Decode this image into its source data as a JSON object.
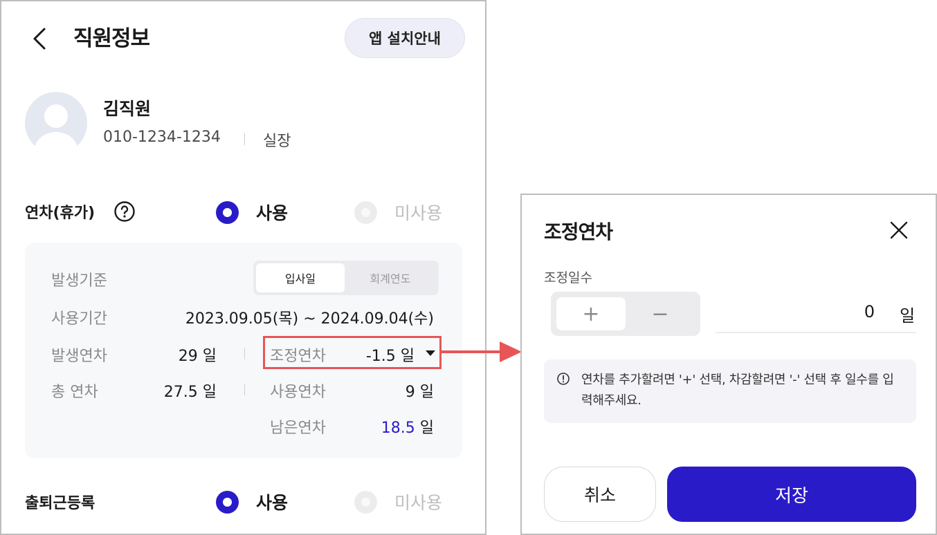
{
  "header": {
    "title": "직원정보",
    "install_label": "앱 설치안내"
  },
  "profile": {
    "name": "김직원",
    "phone": "010-1234-1234",
    "role": "실장"
  },
  "leave": {
    "label": "연차(휴가)",
    "radio_use": "사용",
    "radio_unuse": "미사용",
    "basis_label": "발생기준",
    "basis_options": [
      "입사일",
      "회계연도"
    ],
    "period_label": "사용기간",
    "period_value": "2023.09.05(목) ~ 2024.09.04(수)",
    "occurred_label": "발생연차",
    "occurred_value": "29 일",
    "adjust_label": "조정연차",
    "adjust_value": "-1.5 일",
    "total_label": "총 연차",
    "total_value": "27.5 일",
    "used_label": "사용연차",
    "used_value": "9 일",
    "remaining_label": "남은연차",
    "remaining_number": "18.5",
    "remaining_unit": "일"
  },
  "attendance": {
    "label": "출퇴근등록",
    "radio_use": "사용",
    "radio_unuse": "미사용"
  },
  "dialog": {
    "title": "조정연차",
    "field_label": "조정일수",
    "plus": "+",
    "minus": "−",
    "value": "0",
    "unit": "일",
    "info": "연차를 추가할려면 '+' 선택, 차감할려면 '-' 선택 후 일수를 입력해주세요.",
    "cancel": "취소",
    "save": "저장"
  },
  "colors": {
    "primary": "#2a1bc8",
    "highlight_border": "#e75656"
  },
  "icons": [
    "back-icon",
    "help-icon",
    "avatar-person-icon",
    "dropdown-arrow-icon",
    "close-icon",
    "info-icon",
    "arrow-right-icon"
  ]
}
